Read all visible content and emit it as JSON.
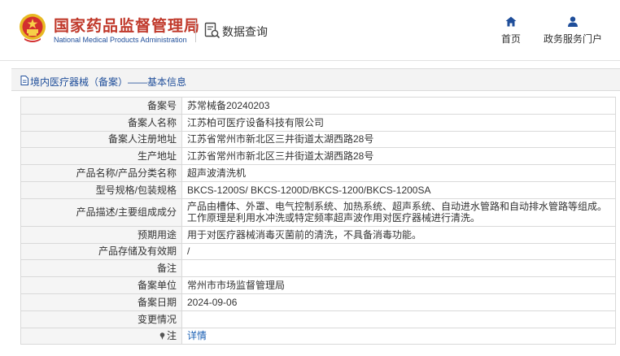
{
  "header": {
    "brand_cn": "国家药品监督管理局",
    "brand_en": "National Medical Products Administration",
    "query_label": "数据查询",
    "nav": {
      "home": "首页",
      "portal": "政务服务门户"
    }
  },
  "breadcrumb": {
    "text": "境内医疗器械（备案）——基本信息"
  },
  "record": {
    "rows": [
      {
        "label": "备案号",
        "value": "苏常械备20240203"
      },
      {
        "label": "备案人名称",
        "value": "江苏柏可医疗设备科技有限公司"
      },
      {
        "label": "备案人注册地址",
        "value": "江苏省常州市新北区三井街道太湖西路28号"
      },
      {
        "label": "生产地址",
        "value": "江苏省常州市新北区三井街道太湖西路28号"
      },
      {
        "label": "产品名称/产品分类名称",
        "value": "超声波清洗机"
      },
      {
        "label": "型号规格/包装规格",
        "value": "BKCS-1200S/ BKCS-1200D/BKCS-1200/BKCS-1200SA"
      },
      {
        "label": "产品描述/主要组成成分",
        "value": "产品由槽体、外罩、电气控制系统、加热系统、超声系统、自动进水管路和自动排水管路等组成。工作原理是利用水冲洗或特定频率超声波作用对医疗器械进行清洗。"
      },
      {
        "label": "预期用途",
        "value": "用于对医疗器械消毒灭菌前的清洗，不具备消毒功能。"
      },
      {
        "label": "产品存储及有效期",
        "value": "/"
      },
      {
        "label": "备注",
        "value": ""
      },
      {
        "label": "备案单位",
        "value": "常州市市场监督管理局"
      },
      {
        "label": "备案日期",
        "value": "2024-09-06"
      },
      {
        "label": "变更情况",
        "value": ""
      },
      {
        "label": "注",
        "value": "详情"
      }
    ]
  },
  "colors": {
    "brand_red": "#c0392b",
    "brand_blue": "#1f4e9a",
    "link_blue": "#1a5fb4",
    "label_bg": "#f5f5f5",
    "border": "#d9d9d9"
  },
  "icons": {
    "emblem": "national-emblem-icon",
    "query": "data-query-icon",
    "home": "home-icon",
    "portal": "user-icon",
    "breadcrumb": "document-icon",
    "note": "pin-icon"
  }
}
